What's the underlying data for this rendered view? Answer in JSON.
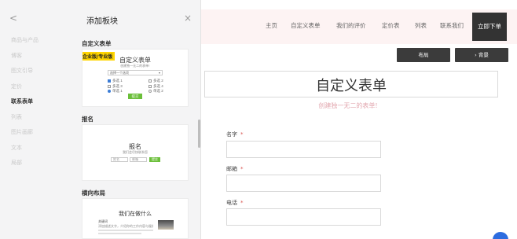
{
  "panel": {
    "back_icon": "chevron-left-icon",
    "back_glyph": "<",
    "title": "添加板块",
    "close_icon": "close-icon",
    "close_glyph": "×",
    "categories": [
      {
        "label": "商品与产品",
        "active": false
      },
      {
        "label": "博客",
        "active": false
      },
      {
        "label": "图文引导",
        "active": false
      },
      {
        "label": "定价",
        "active": false
      },
      {
        "label": "联系表单",
        "active": true
      },
      {
        "label": "列表",
        "active": false
      },
      {
        "label": "图片画廊",
        "active": false
      },
      {
        "label": "文本",
        "active": false
      },
      {
        "label": "局部",
        "active": false
      }
    ],
    "sections": [
      {
        "title": "自定义表单",
        "preview": {
          "badge": "企业版/专业版",
          "heading": "自定义表单",
          "subheading": "创建独一无二的表单!",
          "select_value": "选择一个选项",
          "options": [
            "多选 1",
            "多选 2",
            "多选 3",
            "多选 4",
            "单选 1",
            "单选 2"
          ],
          "submit": "提交"
        }
      },
      {
        "title": "报名",
        "preview": {
          "heading": "报名",
          "subheading": "我们会尽快联系您",
          "input_1": "姓名",
          "input_2": "邮箱",
          "button": "提交"
        }
      },
      {
        "title": "横向布局",
        "preview": {
          "heading": "我们在做什么",
          "label": "关键词",
          "text": "添加描述文字，介绍你的工作内容与服务。"
        }
      }
    ]
  },
  "site": {
    "nav": [
      "主页",
      "自定义表单",
      "我们的评价",
      "定价表",
      "列表",
      "联系我们"
    ],
    "nav_cta": "立即下单",
    "tools": {
      "layout": "布局",
      "background": "› 背景"
    },
    "form": {
      "title": "自定义表单",
      "subtitle": "创建独一无二的表单!",
      "fields": [
        {
          "label": "名字",
          "required_mark": "*"
        },
        {
          "label": "邮箱",
          "required_mark": "*"
        },
        {
          "label": "电话",
          "required_mark": "*"
        }
      ]
    }
  },
  "colors": {
    "accent_green": "#6bbf3a",
    "badge_yellow": "#ffd400",
    "nav_bg": "#fdf3f3",
    "dark_button": "#333333",
    "subtitle_pink": "#e2a5ad"
  }
}
